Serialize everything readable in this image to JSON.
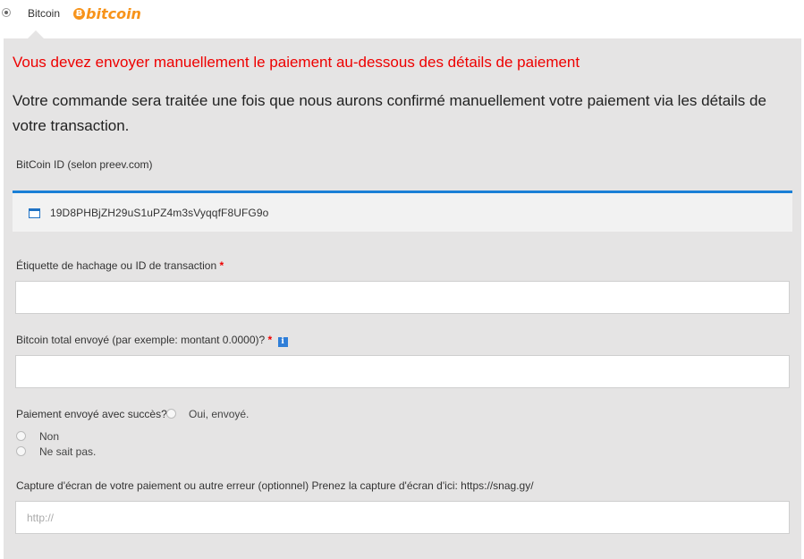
{
  "payment_method": {
    "label": "Bitcoin",
    "logo_symbol": "Ƀ",
    "logo_word": "bitcoin",
    "brand_color": "#f7931a"
  },
  "notice": {
    "warning": "Vous devez envoyer manuellement le paiement au-dessous des détails de paiement",
    "info": "Votre commande sera traitée une fois que nous aurons confirmé manuellement votre paiement via les détails de votre transaction.",
    "warning_color": "#ee0000"
  },
  "bitcoin_id": {
    "label": "BitCoin ID (selon preev.com)",
    "address": "19D8PHBjZH29uS1uPZ4m3sVyqqfF8UFG9o",
    "icon": "wallet-icon",
    "accent_color": "#1a7fd6"
  },
  "hash_field": {
    "label": "Étiquette de hachage ou ID de transaction",
    "required_mark": "*",
    "value": ""
  },
  "amount_field": {
    "label": "Bitcoin total envoyé (par exemple: montant 0.0000)?",
    "required_mark": "*",
    "info_icon": "i",
    "value": ""
  },
  "payment_status": {
    "label": "Paiement envoyé avec succès?",
    "options": [
      "Oui, envoyé.",
      "Non",
      "Ne sait pas."
    ]
  },
  "screenshot_field": {
    "label": "Capture d'écran de votre paiement ou autre erreur (optionnel) Prenez la capture d'écran d'ici: https://snag.gy/",
    "placeholder": "http://",
    "value": ""
  }
}
